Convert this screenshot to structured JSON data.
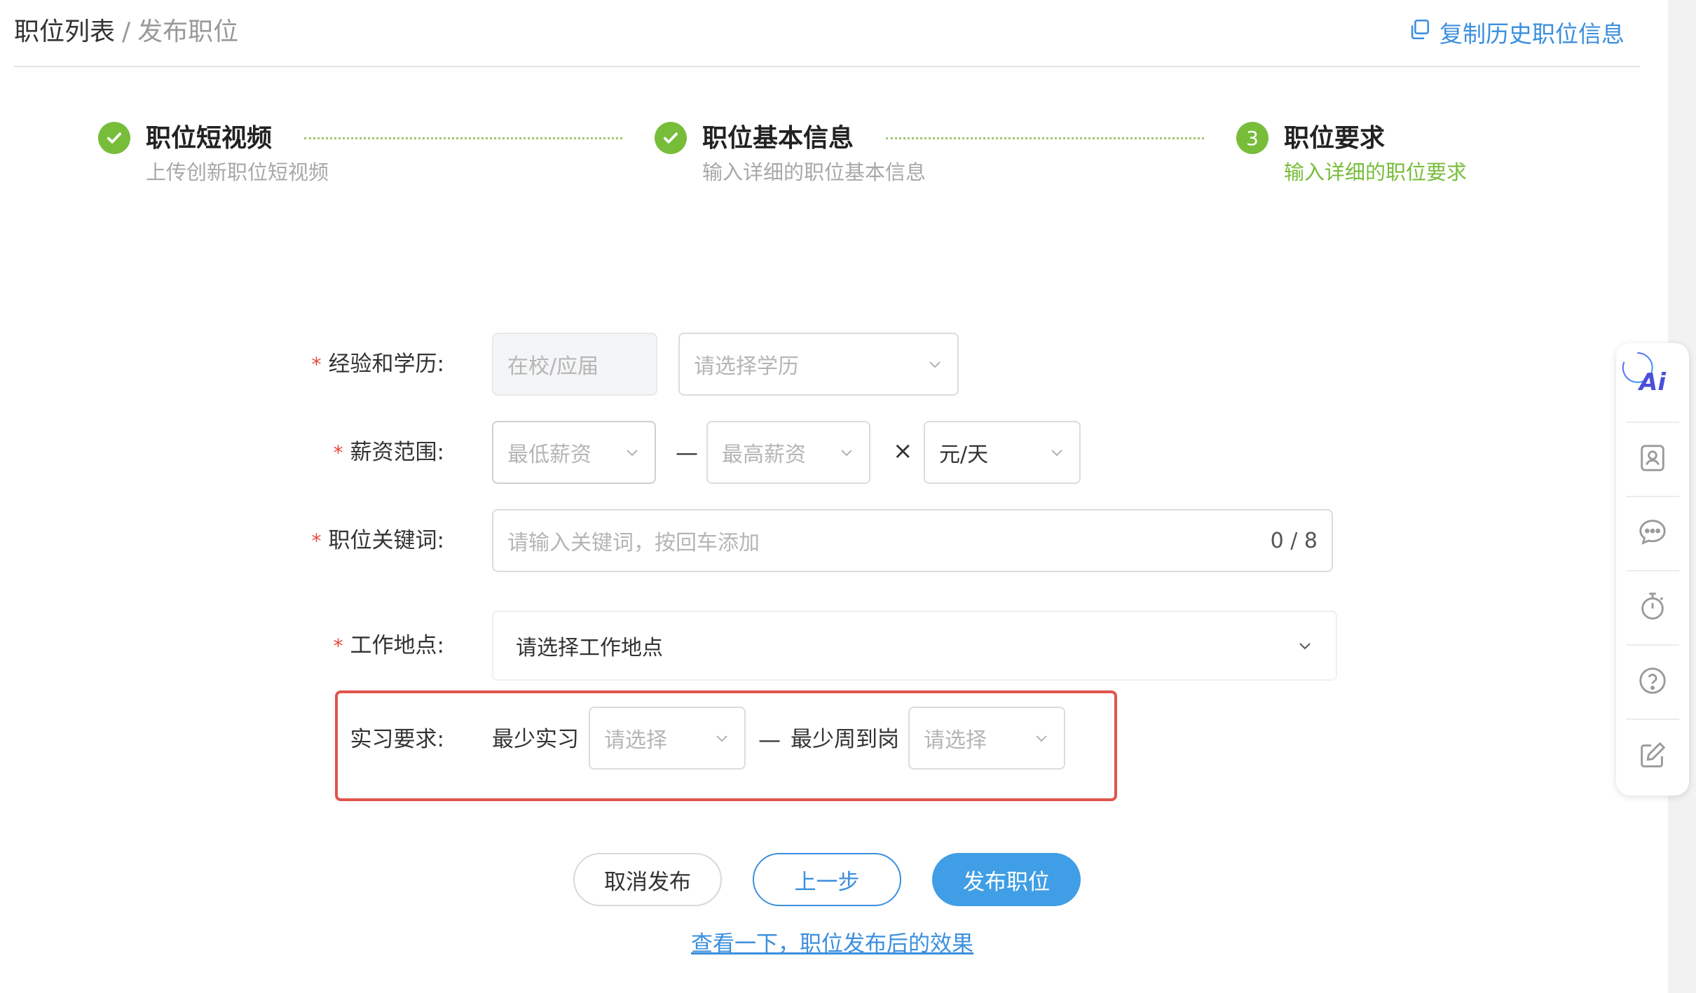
{
  "breadcrumb": {
    "first": "职位列表",
    "separator": "/",
    "current": "发布职位"
  },
  "header": {
    "copy_history": "复制历史职位信息"
  },
  "steps": [
    {
      "title": "职位短视频",
      "desc": "上传创新职位短视频",
      "status": "done"
    },
    {
      "title": "职位基本信息",
      "desc": "输入详细的职位基本信息",
      "status": "done"
    },
    {
      "title": "职位要求",
      "desc": "输入详细的职位要求",
      "status": "active",
      "number": "3"
    }
  ],
  "form": {
    "required_mark": "*",
    "experience": {
      "label": "经验和学历:",
      "experience_value": "在校/应届",
      "education_placeholder": "请选择学历"
    },
    "salary": {
      "label": "薪资范围:",
      "min_placeholder": "最低薪资",
      "dash": "—",
      "max_placeholder": "最高薪资",
      "times": "×",
      "unit": "元/天"
    },
    "keywords": {
      "label": "职位关键词:",
      "placeholder": "请输入关键词，按回车添加",
      "counter": "0 / 8"
    },
    "location": {
      "label": "工作地点:",
      "placeholder": "请选择工作地点"
    },
    "internship": {
      "label": "实习要求:",
      "min_months_label": "最少实习",
      "min_months_placeholder": "请选择",
      "dash": "—",
      "min_days_label": "最少周到岗",
      "min_days_placeholder": "请选择"
    }
  },
  "buttons": {
    "cancel": "取消发布",
    "prev": "上一步",
    "publish": "发布职位"
  },
  "preview_link": "查看一下，职位发布后的效果",
  "toolbar": {
    "ai_label": "Ai"
  },
  "colors": {
    "primary": "#409ee6",
    "link": "#3b8fde",
    "success": "#77bd3a",
    "required": "#e84a3c",
    "highlight": "#e0554a"
  }
}
